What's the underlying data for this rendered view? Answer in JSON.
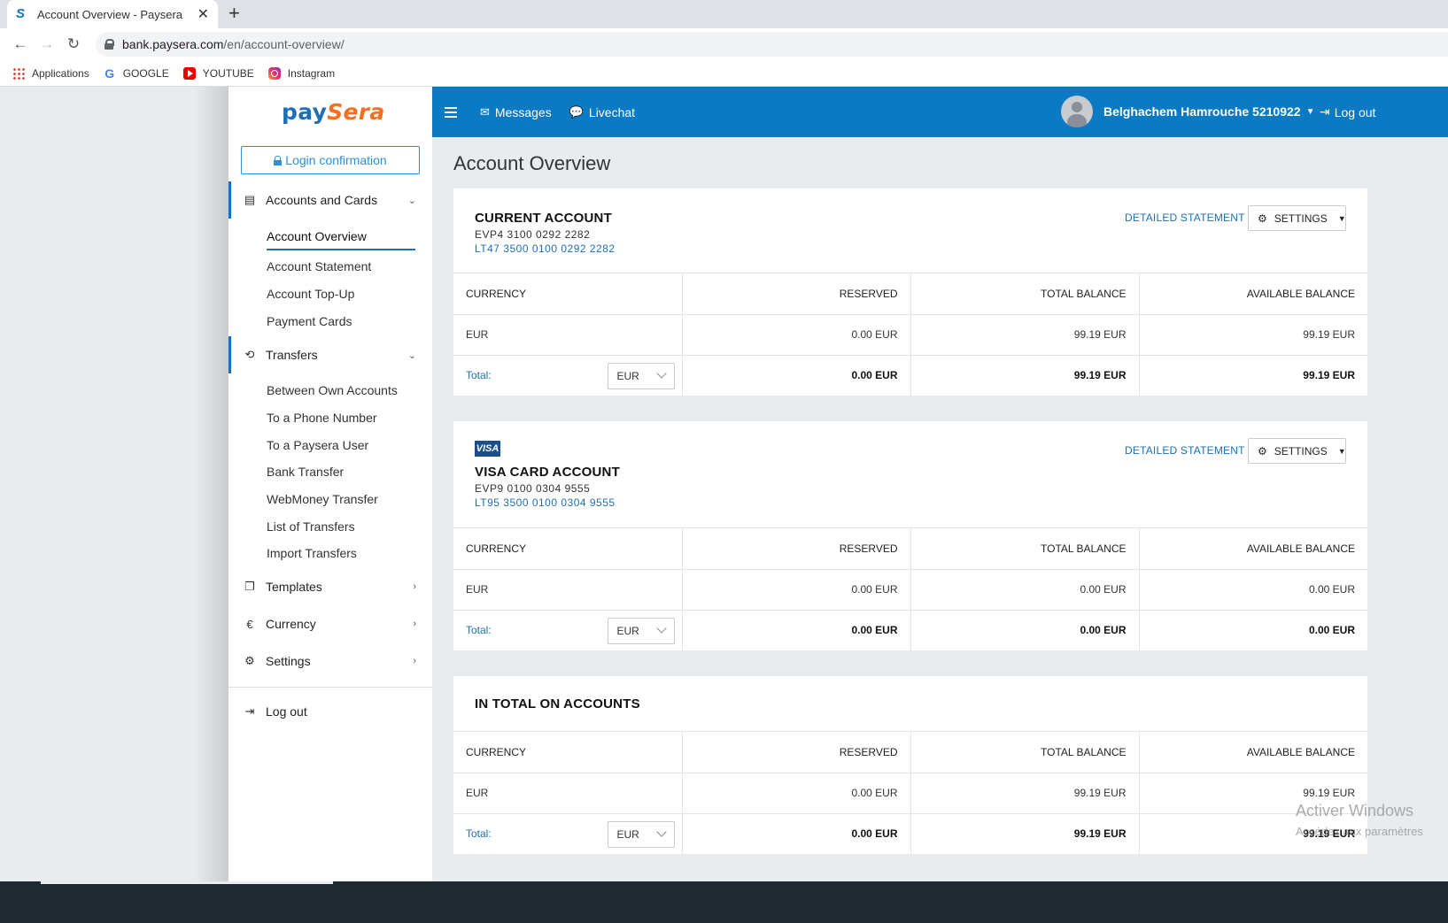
{
  "browser": {
    "tab_title": "Account Overview - Paysera",
    "tab_close": "✕",
    "new_tab": "+",
    "url_host": "bank.paysera.com",
    "url_path": "/en/account-overview/",
    "bookmarks": [
      {
        "label": "Applications",
        "icon": "apps-grid-icon"
      },
      {
        "label": "GOOGLE",
        "icon": "google-icon"
      },
      {
        "label": "YOUTUBE",
        "icon": "youtube-icon"
      },
      {
        "label": "Instagram",
        "icon": "instagram-icon"
      }
    ]
  },
  "logo": {
    "part1": "pay",
    "part2": "Sera"
  },
  "sidebar": {
    "login_confirmation": "Login confirmation",
    "accounts_and_cards": "Accounts and Cards",
    "accounts_items": [
      "Account Overview",
      "Account Statement",
      "Account Top-Up",
      "Payment Cards"
    ],
    "transfers": "Transfers",
    "transfers_items": [
      "Between Own Accounts",
      "To a Phone Number",
      "To a Paysera User",
      "Bank Transfer",
      "WebMoney Transfer",
      "List of Transfers",
      "Import Transfers"
    ],
    "templates": "Templates",
    "currency": "Currency",
    "settings": "Settings",
    "logout": "Log out"
  },
  "topbar": {
    "messages": "Messages",
    "livechat": "Livechat",
    "user_name": "Belghachem Hamrouche 5210922",
    "logout": "Log out",
    "color": "#0b7ac2"
  },
  "page_title": "Account Overview",
  "detailed_statement": "DETAILED STATEMENT",
  "settings_label": "SETTINGS",
  "columns": {
    "currency": "CURRENCY",
    "reserved": "RESERVED",
    "total_balance": "TOTAL BALANCE",
    "available_balance": "AVAILABLE BALANCE"
  },
  "total_label": "Total:",
  "current_account": {
    "title": "CURRENT ACCOUNT",
    "evp": "EVP4 3100 0292 2282",
    "iban": "LT47 3500 0100 0292 2282",
    "row": {
      "currency": "EUR",
      "reserved": "0.00 EUR",
      "total": "99.19 EUR",
      "available": "99.19 EUR"
    },
    "total_row": {
      "select": "EUR",
      "reserved": "0.00 EUR",
      "total": "99.19 EUR",
      "available": "99.19 EUR"
    }
  },
  "visa_account": {
    "badge": "VISA",
    "title": "VISA CARD ACCOUNT",
    "evp": "EVP9 0100 0304 9555",
    "iban": "LT95 3500 0100 0304 9555",
    "row": {
      "currency": "EUR",
      "reserved": "0.00 EUR",
      "total": "0.00 EUR",
      "available": "0.00 EUR"
    },
    "total_row": {
      "select": "EUR",
      "reserved": "0.00 EUR",
      "total": "0.00 EUR",
      "available": "0.00 EUR"
    }
  },
  "in_total": {
    "title": "IN TOTAL ON ACCOUNTS",
    "row": {
      "currency": "EUR",
      "reserved": "0.00 EUR",
      "total": "99.19 EUR",
      "available": "99.19 EUR"
    },
    "total_row": {
      "select": "EUR",
      "reserved": "0.00 EUR",
      "total": "99.19 EUR",
      "available": "99.19 EUR"
    }
  },
  "watermark": {
    "line1": "Activer Windows",
    "line2": "Accédez aux paramètres"
  }
}
